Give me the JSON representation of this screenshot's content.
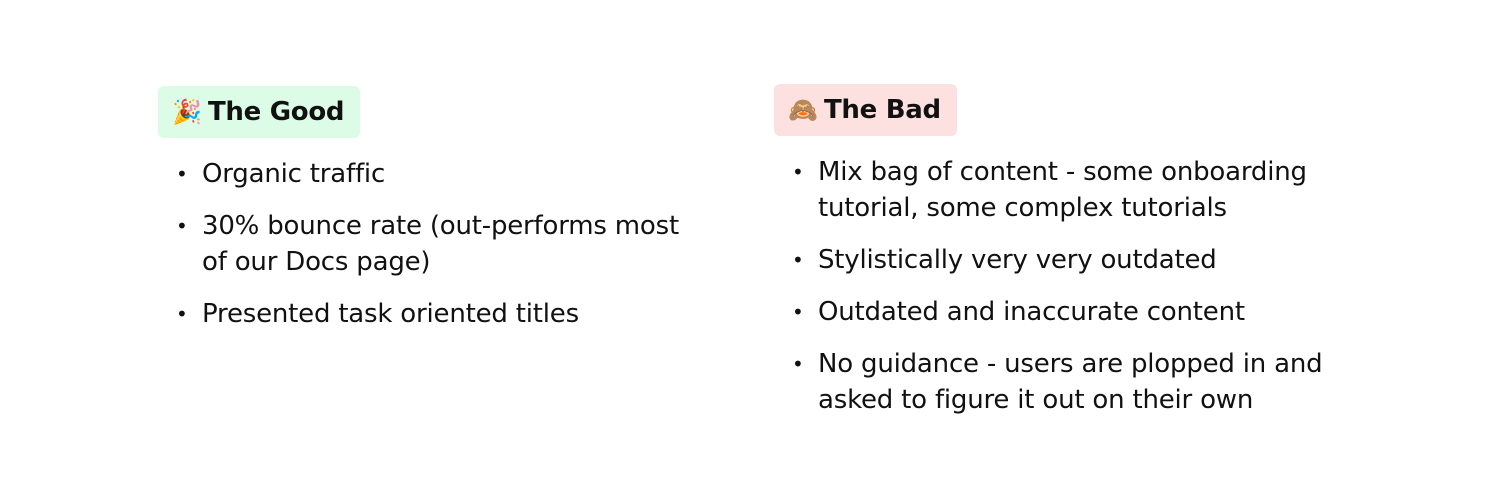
{
  "good": {
    "icon": "party-popper-icon",
    "emoji": "🎉",
    "title": "The Good",
    "color": "#dcfce7",
    "items": [
      "Organic traffic",
      "30% bounce rate (out-performs most of our Docs page)",
      "Presented task oriented titles"
    ]
  },
  "bad": {
    "icon": "see-no-evil-monkey-icon",
    "emoji": "🙈",
    "title": "The Bad",
    "color": "#fde0e0",
    "items": [
      "Mix bag of content - some onboarding tutorial, some complex tutorials",
      "Stylistically very very outdated",
      "Outdated and inaccurate content",
      "No guidance - users are plopped in and asked to figure it out on their own"
    ]
  }
}
